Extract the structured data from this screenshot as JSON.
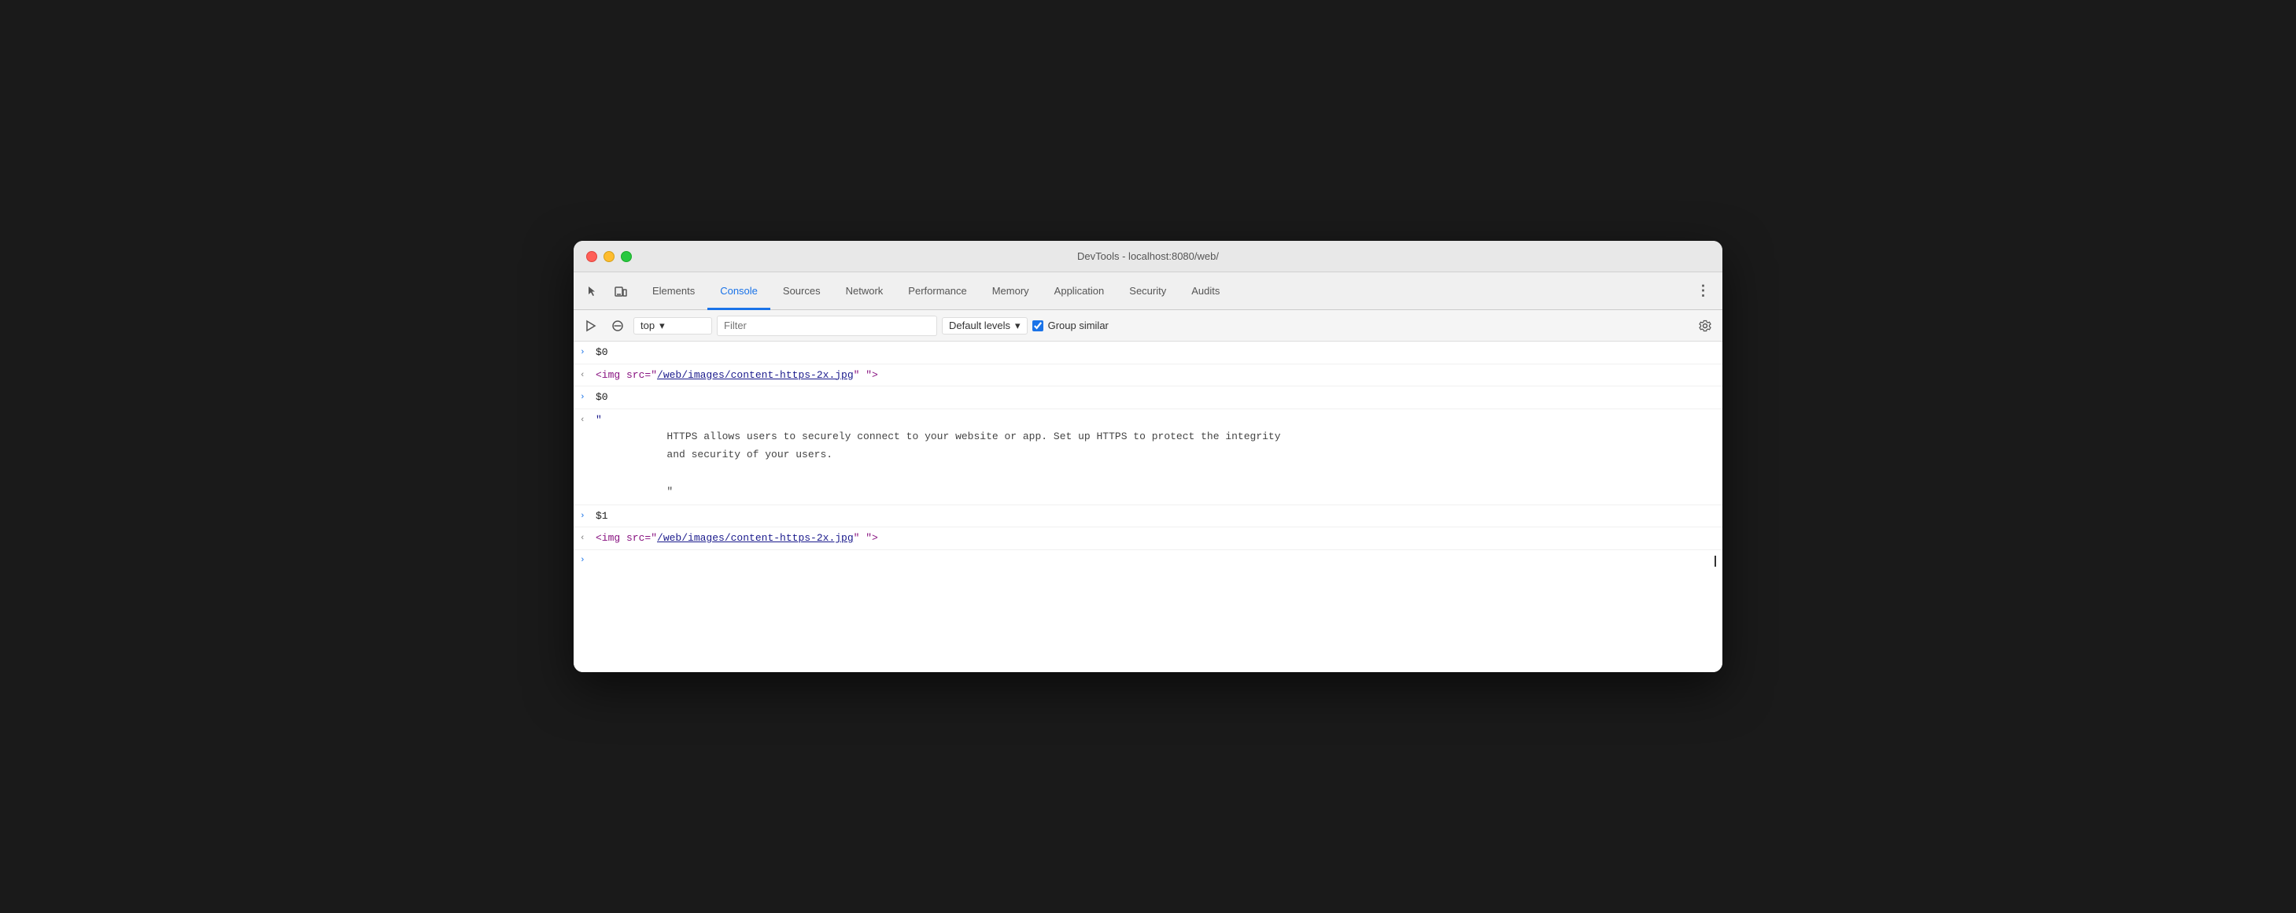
{
  "titleBar": {
    "title": "DevTools - localhost:8080/web/"
  },
  "tabs": [
    {
      "id": "elements",
      "label": "Elements",
      "active": false
    },
    {
      "id": "console",
      "label": "Console",
      "active": true
    },
    {
      "id": "sources",
      "label": "Sources",
      "active": false
    },
    {
      "id": "network",
      "label": "Network",
      "active": false
    },
    {
      "id": "performance",
      "label": "Performance",
      "active": false
    },
    {
      "id": "memory",
      "label": "Memory",
      "active": false
    },
    {
      "id": "application",
      "label": "Application",
      "active": false
    },
    {
      "id": "security",
      "label": "Security",
      "active": false
    },
    {
      "id": "audits",
      "label": "Audits",
      "active": false
    }
  ],
  "consoleToolbar": {
    "contextValue": "top",
    "filterPlaceholder": "Filter",
    "levelsLabel": "Default levels",
    "groupSimilarLabel": "Group similar",
    "groupSimilarChecked": true
  },
  "consoleEntries": [
    {
      "id": "entry1",
      "type": "prompt",
      "arrow": ">",
      "text": "$0"
    },
    {
      "id": "entry2",
      "type": "result",
      "arrow": "<",
      "prefix": "<img src=\"",
      "link": "/web/images/content-https-2x.jpg",
      "suffix": "\" \">"
    },
    {
      "id": "entry3",
      "type": "prompt",
      "arrow": ">",
      "text": "$0"
    },
    {
      "id": "entry4",
      "type": "result-multiline",
      "arrow": "<",
      "quote_open": "\"",
      "body": "        HTTPS allows users to securely connect to your website or app. Set up HTTPS to protect the integrity\n        and security of your users.\n\n        \"",
      "quote_close": ""
    },
    {
      "id": "entry5",
      "type": "prompt",
      "arrow": ">",
      "text": "$1"
    },
    {
      "id": "entry6",
      "type": "result",
      "arrow": "<",
      "prefix": "<img src=\"",
      "link": "/web/images/content-https-2x.jpg",
      "suffix": "\" \">"
    }
  ],
  "consoleInput": {
    "arrow": ">"
  }
}
